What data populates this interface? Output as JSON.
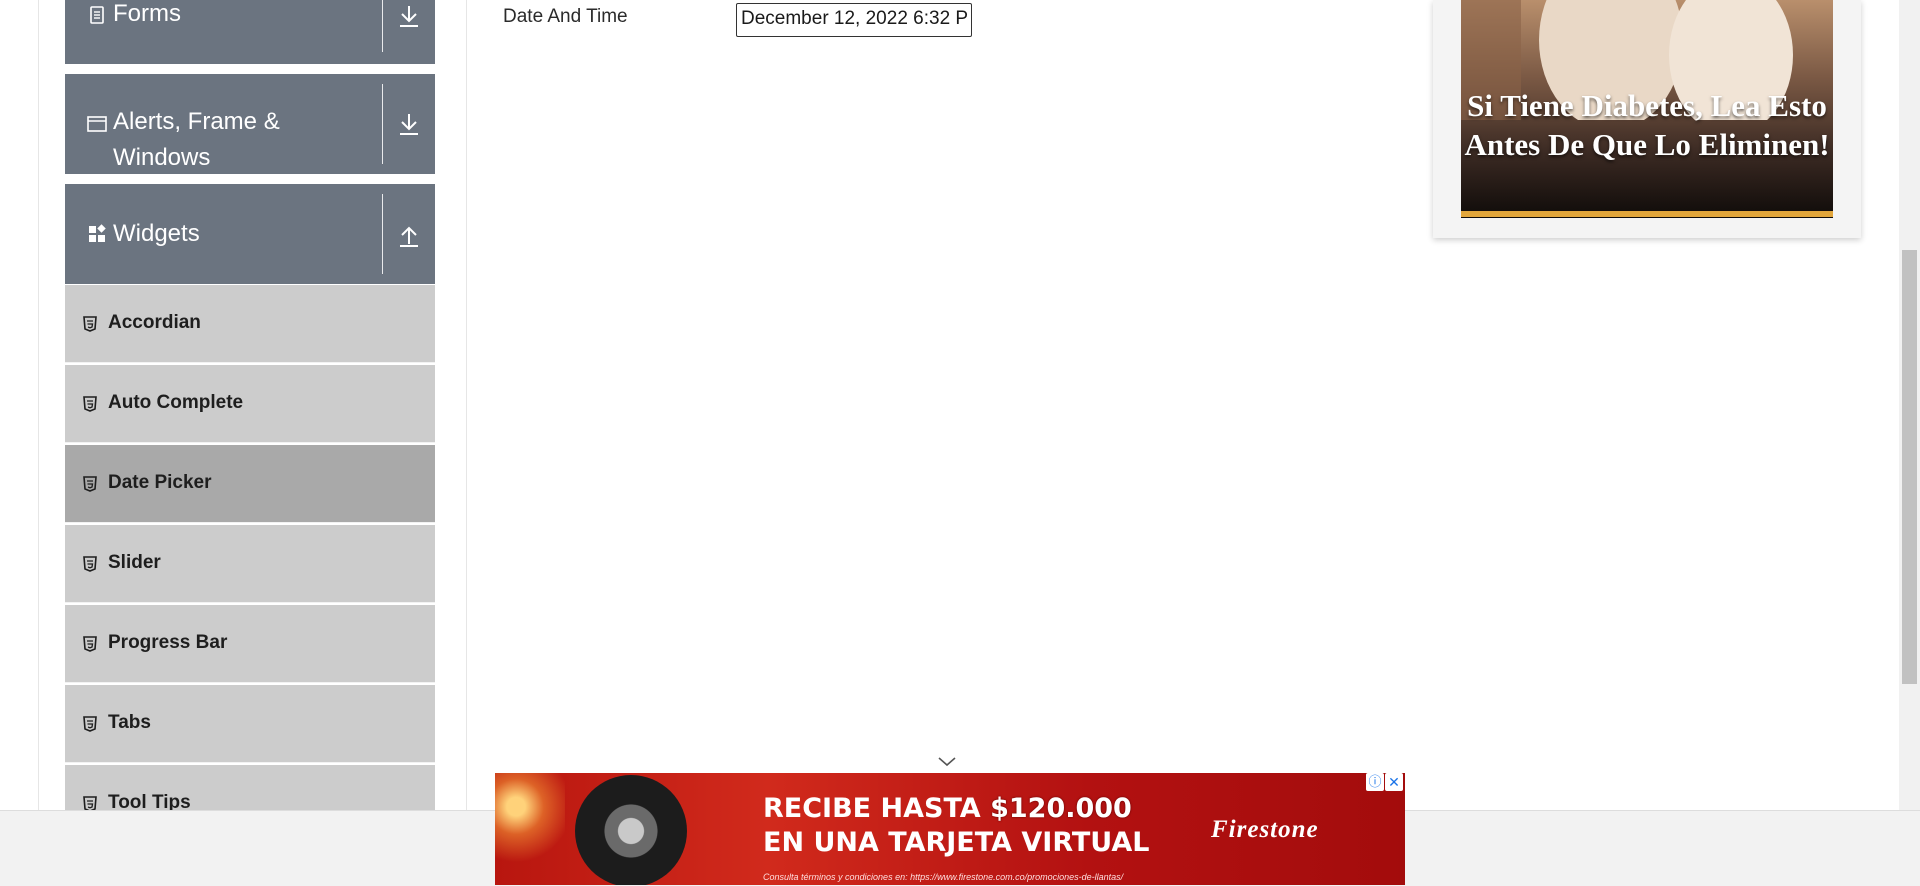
{
  "sidebar": {
    "groups": [
      {
        "label": "Forms",
        "icon": "document-icon",
        "toggle": "download-arrow-icon"
      },
      {
        "label": "Alerts, Frame &",
        "label_line2": "Windows",
        "icon": "window-icon",
        "toggle": "download-arrow-icon"
      },
      {
        "label": "Widgets",
        "icon": "widgets-icon",
        "toggle": "upload-arrow-icon"
      }
    ],
    "items": [
      {
        "label": "Accordian"
      },
      {
        "label": "Auto Complete"
      },
      {
        "label": "Date Picker",
        "active": true
      },
      {
        "label": "Slider"
      },
      {
        "label": "Progress Bar"
      },
      {
        "label": "Tabs"
      },
      {
        "label": "Tool Tips"
      }
    ],
    "colors": {
      "header_bg": "#6b7480",
      "item_bg": "#cccccc",
      "item_active_bg": "#a9a9a9"
    }
  },
  "main": {
    "date_time_label": "Date And Time",
    "date_time_value": "December 12, 2022 6:32 P"
  },
  "ad_right": {
    "headline": "Si Tiene Diabetes, Lea Esto Antes De Que Lo Eliminen!"
  },
  "banner_ad": {
    "line1_prefix": "RECIBE HASTA ",
    "line1_amount": "$120.000",
    "line2": "EN UNA TARJETA VIRTUAL",
    "legal": "Consulta términos y condiciones en: https://www.firestone.com.co/promociones-de-llantas/",
    "brand": "Firestone",
    "info_glyph": "ⓘ",
    "close_glyph": "✕",
    "colors": {
      "background": "#c21a12"
    }
  }
}
